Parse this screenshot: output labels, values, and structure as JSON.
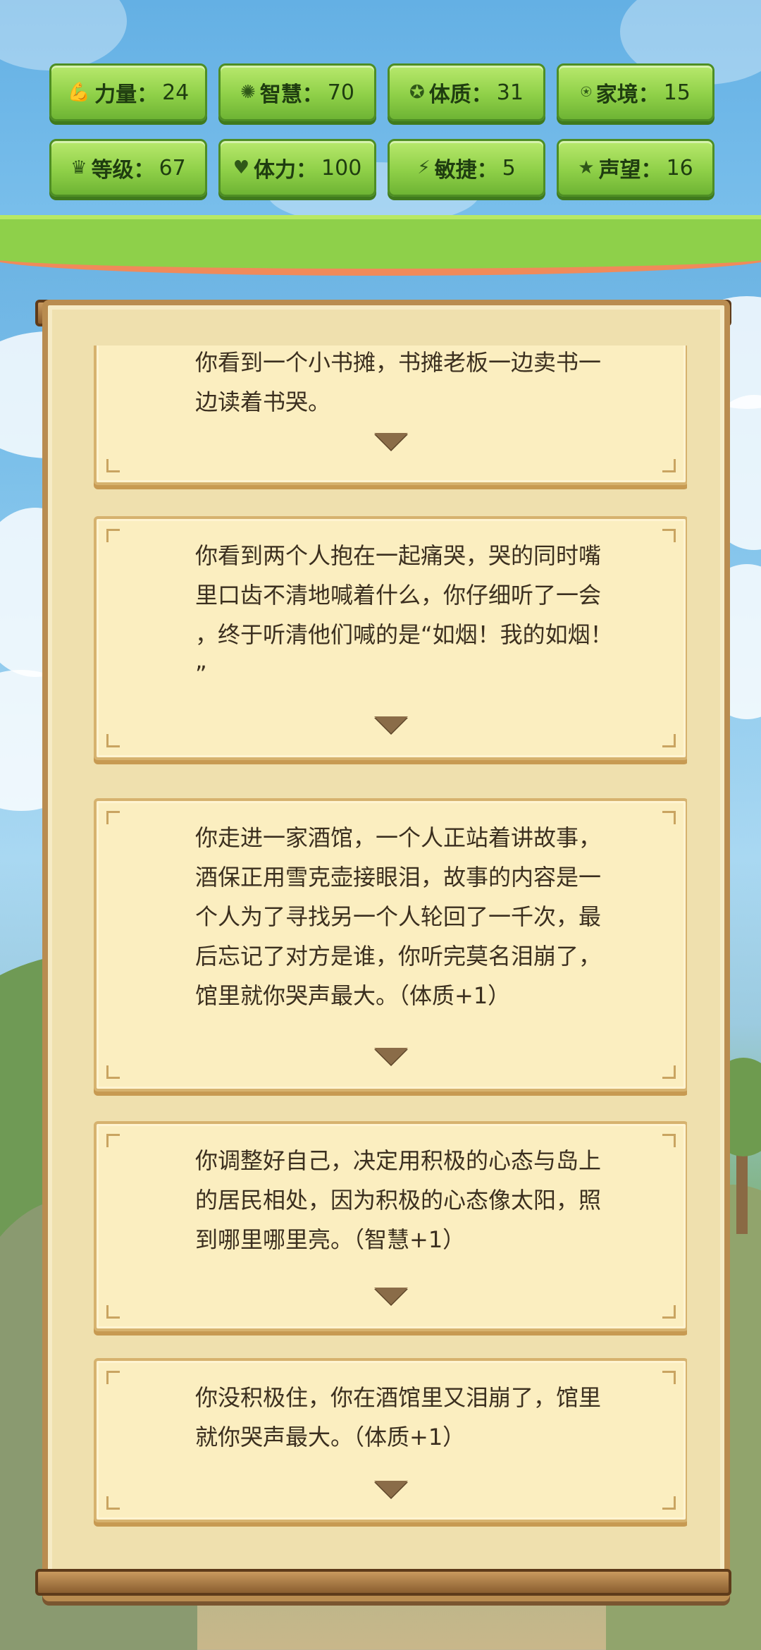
{
  "stats": [
    {
      "icon": "strength-icon",
      "glyph": "💪",
      "label": "力量：",
      "value": "24"
    },
    {
      "icon": "wisdom-icon",
      "glyph": "✺",
      "label": "智慧：",
      "value": "70"
    },
    {
      "icon": "constitution-icon",
      "glyph": "✪",
      "label": "体质：",
      "value": "31"
    },
    {
      "icon": "family-icon",
      "glyph": "⍟",
      "label": "家境：",
      "value": "15"
    },
    {
      "icon": "level-icon",
      "glyph": "♛",
      "label": "等级：",
      "value": "67"
    },
    {
      "icon": "stamina-icon",
      "glyph": "♥",
      "label": "体力：",
      "value": "100"
    },
    {
      "icon": "agility-icon",
      "glyph": "⚡",
      "label": "敏捷：",
      "value": "5"
    },
    {
      "icon": "reputation-icon",
      "glyph": "★",
      "label": "声望：",
      "value": "16"
    }
  ],
  "events": [
    {
      "text": "你看到一个小书摊，书摊老板一边卖书一\n边读着书哭。"
    },
    {
      "text": "你看到两个人抱在一起痛哭，哭的同时嘴\n里口齿不清地喊着什么，你仔细听了一会\n，终于听清他们喊的是“如烟！我的如烟！\n”"
    },
    {
      "text": "你走进一家酒馆，一个人正站着讲故事，\n酒保正用雪克壶接眼泪，故事的内容是一\n个人为了寻找另一个人轮回了一千次，最\n后忘记了对方是谁，你听完莫名泪崩了，\n馆里就你哭声最大。（体质+1）"
    },
    {
      "text": "你调整好自己，决定用积极的心态与岛上\n的居民相处，因为积极的心态像太阳，照\n到哪里哪里亮。（智慧+1）"
    },
    {
      "text": "你没积极住，你在酒馆里又泪崩了，馆里\n就你哭声最大。（体质+1）"
    }
  ]
}
